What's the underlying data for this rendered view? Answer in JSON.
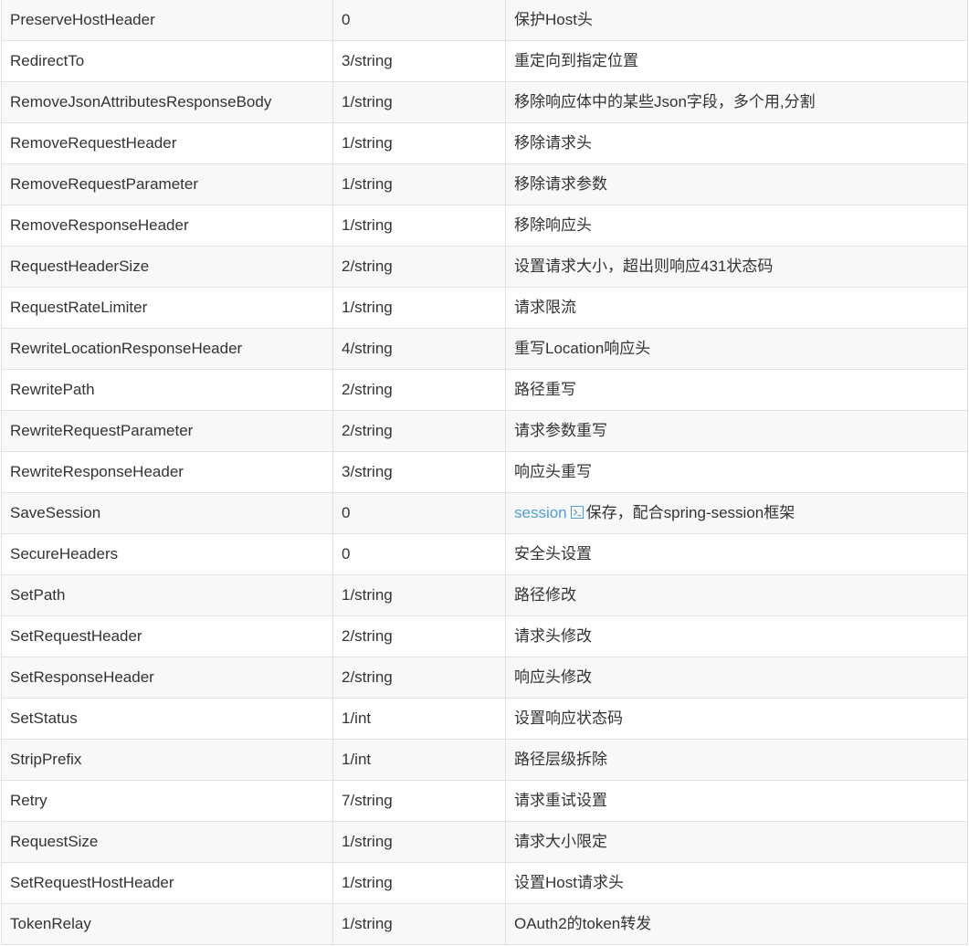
{
  "colors": {
    "text": "#333333",
    "link": "#4f9fd6",
    "border": "#dfe2e5",
    "stripe": "#f8f8f8"
  },
  "rows": [
    {
      "name": "PreserveHostHeader",
      "args": "0",
      "desc": "保护Host头"
    },
    {
      "name": "RedirectTo",
      "args": "3/string",
      "desc": "重定向到指定位置"
    },
    {
      "name": "RemoveJsonAttributesResponseBody",
      "args": "1/string",
      "desc": "移除响应体中的某些Json字段，多个用,分割"
    },
    {
      "name": "RemoveRequestHeader",
      "args": "1/string",
      "desc": "移除请求头"
    },
    {
      "name": "RemoveRequestParameter",
      "args": "1/string",
      "desc": "移除请求参数"
    },
    {
      "name": "RemoveResponseHeader",
      "args": "1/string",
      "desc": "移除响应头"
    },
    {
      "name": "RequestHeaderSize",
      "args": "2/string",
      "desc": "设置请求大小，超出则响应431状态码"
    },
    {
      "name": "RequestRateLimiter",
      "args": "1/string",
      "desc": "请求限流"
    },
    {
      "name": "RewriteLocationResponseHeader",
      "args": "4/string",
      "desc": "重写Location响应头"
    },
    {
      "name": "RewritePath",
      "args": "2/string",
      "desc": "路径重写"
    },
    {
      "name": "RewriteRequestParameter",
      "args": "2/string",
      "desc": "请求参数重写"
    },
    {
      "name": "RewriteResponseHeader",
      "args": "3/string",
      "desc": "响应头重写"
    },
    {
      "name": "SaveSession",
      "args": "0",
      "desc_link": "session",
      "link_icon": "external-link-icon",
      "desc": "保存，配合spring-session框架"
    },
    {
      "name": "SecureHeaders",
      "args": "0",
      "desc": "安全头设置"
    },
    {
      "name": "SetPath",
      "args": "1/string",
      "desc": "路径修改"
    },
    {
      "name": "SetRequestHeader",
      "args": "2/string",
      "desc": "请求头修改"
    },
    {
      "name": "SetResponseHeader",
      "args": "2/string",
      "desc": "响应头修改"
    },
    {
      "name": "SetStatus",
      "args": "1/int",
      "desc": "设置响应状态码"
    },
    {
      "name": "StripPrefix",
      "args": "1/int",
      "desc": "路径层级拆除"
    },
    {
      "name": "Retry",
      "args": "7/string",
      "desc": "请求重试设置"
    },
    {
      "name": "RequestSize",
      "args": "1/string",
      "desc": "请求大小限定"
    },
    {
      "name": "SetRequestHostHeader",
      "args": "1/string",
      "desc": "设置Host请求头"
    },
    {
      "name": "TokenRelay",
      "args": "1/string",
      "desc": "OAuth2的token转发"
    }
  ]
}
